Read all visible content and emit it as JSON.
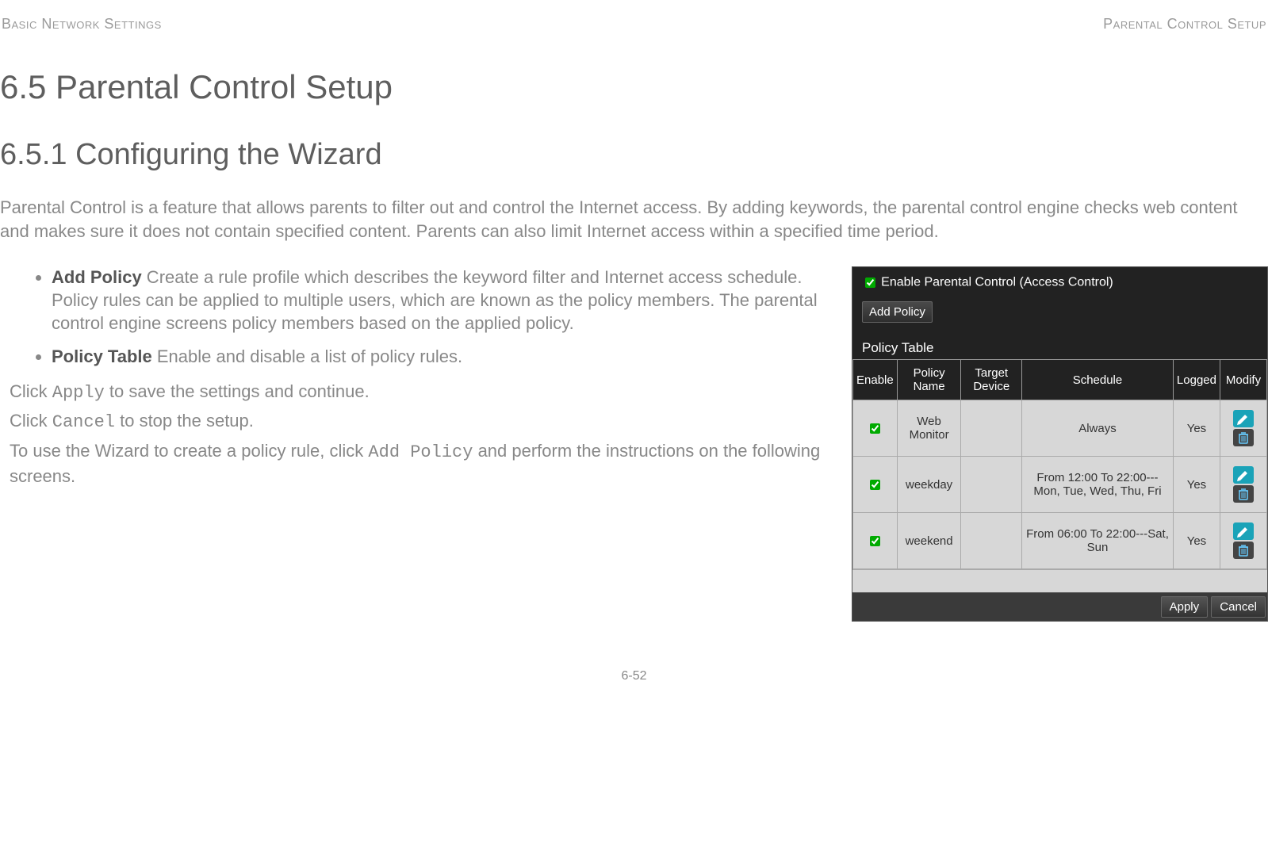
{
  "header": {
    "left": "Basic Network Settings",
    "right": "Parental Control Setup"
  },
  "section_title": "6.5 Parental Control Setup",
  "subsection_title": "6.5.1 Configuring the Wizard",
  "intro": "Parental Control is a feature that allows parents to filter out and control the Internet access. By adding keywords, the parental control engine checks web content and makes sure it does not contain specified content. Parents can also limit Internet access within a specified time period.",
  "bullets": [
    {
      "label": "Add Policy",
      "text": "  Create a rule profile which describes the keyword filter and Internet access schedule. Policy rules can be applied to multiple users, which are known as the policy members. The parental control engine screens policy members based on the applied policy."
    },
    {
      "label": "Policy Table",
      "text": "  Enable and disable a list of policy rules."
    }
  ],
  "para1_pre": "Click ",
  "para1_code": "Apply",
  "para1_post": " to save the settings and continue.",
  "para2_pre": "Click ",
  "para2_code": "Cancel",
  "para2_post": " to stop the setup.",
  "para3_pre": "To use the Wizard to create a policy rule, click ",
  "para3_code": "Add Policy",
  "para3_post": " and perform the instructions on the following screens.",
  "panel": {
    "enable_label": "Enable Parental Control (Access Control)",
    "add_policy_btn": "Add Policy",
    "table_caption": "Policy Table",
    "columns": [
      "Enable",
      "Policy Name",
      "Target Device",
      "Schedule",
      "Logged",
      "Modify"
    ],
    "rows": [
      {
        "enable": true,
        "name": "Web Monitor",
        "target": "",
        "schedule": "Always",
        "logged": "Yes"
      },
      {
        "enable": true,
        "name": "weekday",
        "target": "",
        "schedule": "From 12:00 To 22:00---Mon, Tue, Wed, Thu, Fri",
        "logged": "Yes"
      },
      {
        "enable": true,
        "name": "weekend",
        "target": "",
        "schedule": "From 06:00 To 22:00---Sat, Sun",
        "logged": "Yes"
      }
    ],
    "apply_btn": "Apply",
    "cancel_btn": "Cancel"
  },
  "page_number": "6-52"
}
